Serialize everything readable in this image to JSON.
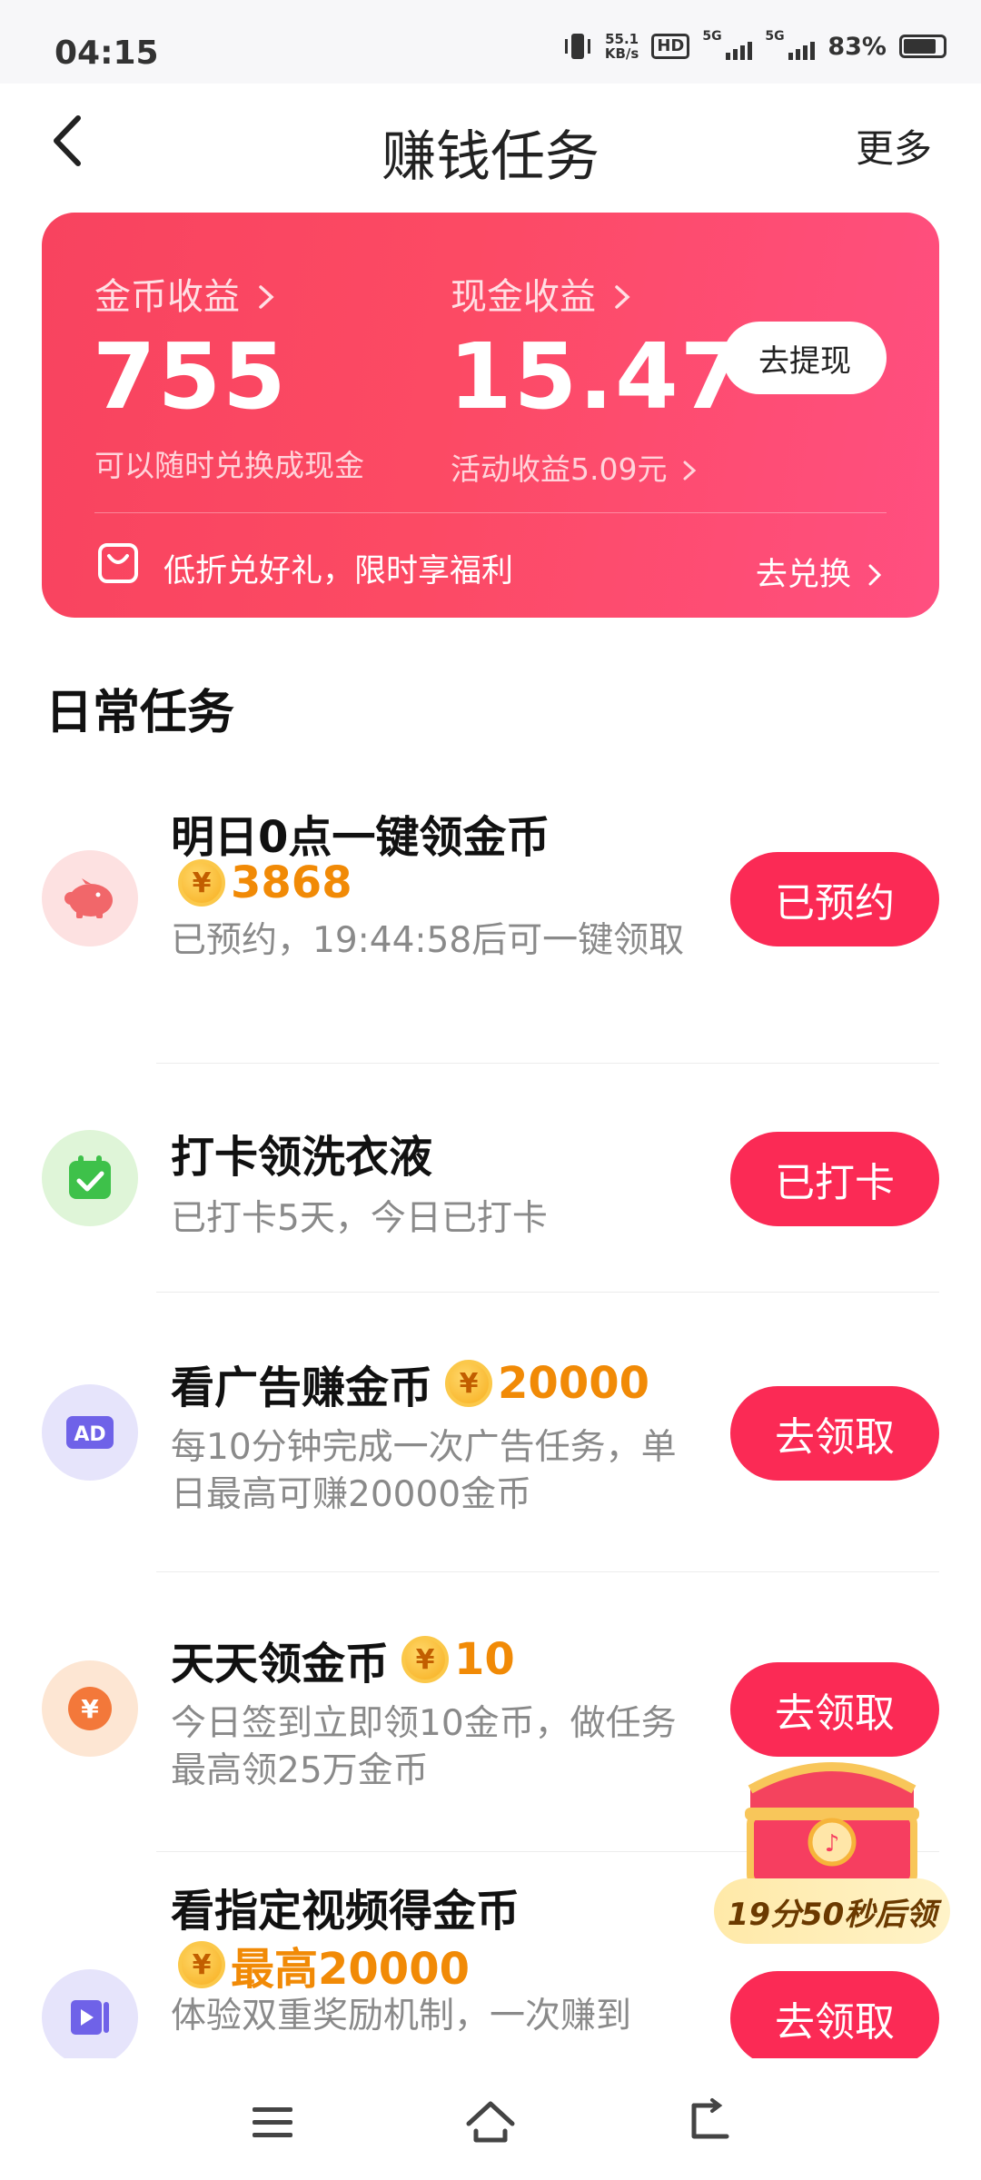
{
  "status_bar": {
    "time": "04:15",
    "net_speed_value": "55.1",
    "net_speed_unit": "KB/s",
    "hd_label": "HD",
    "sim1_label": "5G",
    "sim2_label": "5G",
    "battery_pct": "83%",
    "battery_level": 0.83
  },
  "header": {
    "title": "赚钱任务",
    "more_label": "更多"
  },
  "earnings": {
    "coin_title": "金币收益",
    "coin_value": "755",
    "coin_sub": "可以随时兑换成现金",
    "cash_title": "现金收益",
    "cash_value": "15.47",
    "cash_sub": "活动收益5.09元",
    "withdraw_label": "去提现",
    "promo_text": "低折兑好礼，限时享福利",
    "exchange_label": "去兑换"
  },
  "section_title": "日常任务",
  "tasks": [
    {
      "title": "明日0点一键领金币",
      "coin": "3868",
      "desc": "已预约，19:44:58后可一键领取",
      "button": "已预约",
      "icon": "piggy-bank-icon"
    },
    {
      "title": "打卡领洗衣液",
      "desc": "已打卡5天，今日已打卡",
      "button": "已打卡",
      "icon": "calendar-check-icon"
    },
    {
      "title": "看广告赚金币",
      "coin": "20000",
      "desc": "每10分钟完成一次广告任务，单日最高可赚20000金币",
      "button": "去领取",
      "icon": "ad-icon"
    },
    {
      "title": "天天领金币",
      "coin": "10",
      "desc": "今日签到立即领10金币，做任务最高领25万金币",
      "button": "去领取",
      "icon": "yuan-coin-icon"
    },
    {
      "title": "看指定视频得金币",
      "coin": "最高20000",
      "desc": "体验双重奖励机制，一次赚到",
      "button": "去领取",
      "icon": "video-icon"
    }
  ],
  "floating": {
    "timer": "19分50秒后领"
  },
  "coin_symbol": "¥",
  "colors": {
    "accent": "#fb2a55",
    "coin": "#f18a06",
    "card_start": "#f8435f",
    "card_end": "#ff4f80"
  }
}
